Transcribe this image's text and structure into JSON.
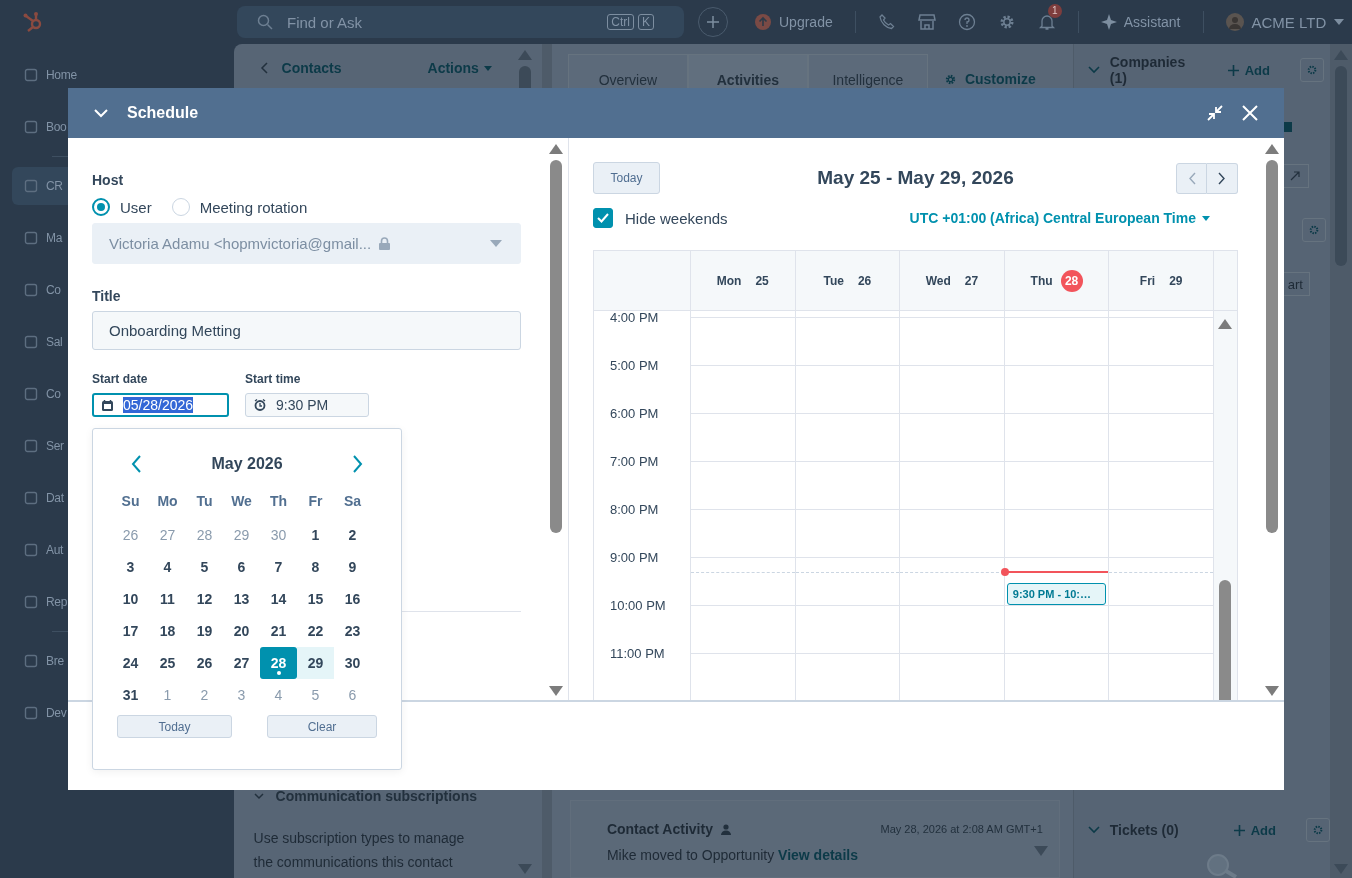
{
  "top_bar": {
    "search_placeholder": "Find or Ask",
    "shortcut_keys": [
      "Ctrl",
      "K"
    ],
    "upgrade": "Upgrade",
    "notification_count": "1",
    "assistant": "Assistant",
    "account": "ACME LTD"
  },
  "sidebar": {
    "items": [
      {
        "label": "Home",
        "selected": false
      },
      {
        "label": "Boo",
        "selected": false
      },
      {
        "label": "CR",
        "selected": true
      },
      {
        "label": "Ma",
        "selected": false
      },
      {
        "label": "Co",
        "selected": false
      },
      {
        "label": "Sal",
        "selected": false
      },
      {
        "label": "Co",
        "selected": false
      },
      {
        "label": "Ser",
        "selected": false
      },
      {
        "label": "Dat",
        "selected": false
      },
      {
        "label": "Aut",
        "selected": false
      },
      {
        "label": "Rep",
        "selected": false
      },
      {
        "label": "Bre",
        "selected": false
      },
      {
        "label": "Dev",
        "selected": false
      }
    ]
  },
  "contact_panel": {
    "back_link": "Contacts",
    "actions": "Actions",
    "section": "Communication subscriptions",
    "note": "Use subscription types to manage the communications this contact"
  },
  "record_tabs": [
    {
      "label": "Overview",
      "selected": false
    },
    {
      "label": "Activities",
      "selected": true
    },
    {
      "label": "Intelligence",
      "selected": false
    }
  ],
  "customize": "Customize",
  "activity_card": {
    "title": "Contact Activity",
    "timestamp": "May 28, 2026 at 2:08 AM GMT+1",
    "text": "Mike moved to Opportunity",
    "link": "View details"
  },
  "right_panel": {
    "sections": [
      {
        "title": "Companies (1)",
        "add": "Add"
      },
      {
        "title": "Tickets (0)",
        "add": "Add"
      }
    ],
    "partial_button": "art"
  },
  "modal": {
    "title": "Schedule",
    "host": {
      "label": "Host",
      "options": [
        {
          "label": "User",
          "selected": true
        },
        {
          "label": "Meeting rotation",
          "selected": false
        }
      ],
      "value": "Victoria Adamu <hopmvictoria@gmail...",
      "locked": true
    },
    "title_field": {
      "label": "Title",
      "value": "Onboarding Metting"
    },
    "start_date": {
      "label": "Start date",
      "value": "05/28/2026"
    },
    "start_time": {
      "label": "Start time",
      "value": "9:30 PM"
    },
    "date_picker": {
      "month": "May 2026",
      "weekdays": [
        "Su",
        "Mo",
        "Tu",
        "We",
        "Th",
        "Fr",
        "Sa"
      ],
      "days": [
        {
          "label": "26",
          "outside": true,
          "selected": false,
          "today": false,
          "hovered": false
        },
        {
          "label": "27",
          "outside": true,
          "selected": false,
          "today": false,
          "hovered": false
        },
        {
          "label": "28",
          "outside": true,
          "selected": false,
          "today": false,
          "hovered": false
        },
        {
          "label": "29",
          "outside": true,
          "selected": false,
          "today": false,
          "hovered": false
        },
        {
          "label": "30",
          "outside": true,
          "selected": false,
          "today": false,
          "hovered": false
        },
        {
          "label": "1",
          "outside": false,
          "selected": false,
          "today": false,
          "hovered": false
        },
        {
          "label": "2",
          "outside": false,
          "selected": false,
          "today": false,
          "hovered": false
        },
        {
          "label": "3",
          "outside": false,
          "selected": false,
          "today": false,
          "hovered": false
        },
        {
          "label": "4",
          "outside": false,
          "selected": false,
          "today": false,
          "hovered": false
        },
        {
          "label": "5",
          "outside": false,
          "selected": false,
          "today": false,
          "hovered": false
        },
        {
          "label": "6",
          "outside": false,
          "selected": false,
          "today": false,
          "hovered": false
        },
        {
          "label": "7",
          "outside": false,
          "selected": false,
          "today": false,
          "hovered": false
        },
        {
          "label": "8",
          "outside": false,
          "selected": false,
          "today": false,
          "hovered": false
        },
        {
          "label": "9",
          "outside": false,
          "selected": false,
          "today": false,
          "hovered": false
        },
        {
          "label": "10",
          "outside": false,
          "selected": false,
          "today": false,
          "hovered": false
        },
        {
          "label": "11",
          "outside": false,
          "selected": false,
          "today": false,
          "hovered": false
        },
        {
          "label": "12",
          "outside": false,
          "selected": false,
          "today": false,
          "hovered": false
        },
        {
          "label": "13",
          "outside": false,
          "selected": false,
          "today": false,
          "hovered": false
        },
        {
          "label": "14",
          "outside": false,
          "selected": false,
          "today": false,
          "hovered": false
        },
        {
          "label": "15",
          "outside": false,
          "selected": false,
          "today": false,
          "hovered": false
        },
        {
          "label": "16",
          "outside": false,
          "selected": false,
          "today": false,
          "hovered": false
        },
        {
          "label": "17",
          "outside": false,
          "selected": false,
          "today": false,
          "hovered": false
        },
        {
          "label": "18",
          "outside": false,
          "selected": false,
          "today": false,
          "hovered": false
        },
        {
          "label": "19",
          "outside": false,
          "selected": false,
          "today": false,
          "hovered": false
        },
        {
          "label": "20",
          "outside": false,
          "selected": false,
          "today": false,
          "hovered": false
        },
        {
          "label": "21",
          "outside": false,
          "selected": false,
          "today": false,
          "hovered": false
        },
        {
          "label": "22",
          "outside": false,
          "selected": false,
          "today": false,
          "hovered": false
        },
        {
          "label": "23",
          "outside": false,
          "selected": false,
          "today": false,
          "hovered": false
        },
        {
          "label": "24",
          "outside": false,
          "selected": false,
          "today": false,
          "hovered": false
        },
        {
          "label": "25",
          "outside": false,
          "selected": false,
          "today": false,
          "hovered": false
        },
        {
          "label": "26",
          "outside": false,
          "selected": false,
          "today": false,
          "hovered": false
        },
        {
          "label": "27",
          "outside": false,
          "selected": false,
          "today": false,
          "hovered": false
        },
        {
          "label": "28",
          "outside": false,
          "selected": true,
          "today": true,
          "hovered": false
        },
        {
          "label": "29",
          "outside": false,
          "selected": false,
          "today": false,
          "hovered": true
        },
        {
          "label": "30",
          "outside": false,
          "selected": false,
          "today": false,
          "hovered": false
        },
        {
          "label": "31",
          "outside": false,
          "selected": false,
          "today": false,
          "hovered": false
        },
        {
          "label": "1",
          "outside": true,
          "selected": false,
          "today": false,
          "hovered": false
        },
        {
          "label": "2",
          "outside": true,
          "selected": false,
          "today": false,
          "hovered": false
        },
        {
          "label": "3",
          "outside": true,
          "selected": false,
          "today": false,
          "hovered": false
        },
        {
          "label": "4",
          "outside": true,
          "selected": false,
          "today": false,
          "hovered": false
        },
        {
          "label": "5",
          "outside": true,
          "selected": false,
          "today": false,
          "hovered": false
        },
        {
          "label": "6",
          "outside": true,
          "selected": false,
          "today": false,
          "hovered": false
        }
      ],
      "buttons": [
        "Today",
        "Clear"
      ]
    },
    "calendar": {
      "today_button": "Today",
      "range": "May 25 - May 29, 2026",
      "hide_weekends": {
        "label": "Hide weekends",
        "checked": true
      },
      "timezone": "UTC +01:00 (Africa) Central European Time",
      "days": [
        {
          "weekday": "Mon",
          "date": "25",
          "today": false
        },
        {
          "weekday": "Tue",
          "date": "26",
          "today": false
        },
        {
          "weekday": "Wed",
          "date": "27",
          "today": false
        },
        {
          "weekday": "Thu",
          "date": "28",
          "today": true,
          "events": [
            {
              "label": "9:30 PM - 10:…"
            }
          ]
        },
        {
          "weekday": "Fri",
          "date": "29",
          "today": false
        }
      ],
      "hours": [
        "4:00 PM",
        "5:00 PM",
        "6:00 PM",
        "7:00 PM",
        "8:00 PM",
        "9:00 PM",
        "10:00 PM",
        "11:00 PM"
      ]
    }
  }
}
